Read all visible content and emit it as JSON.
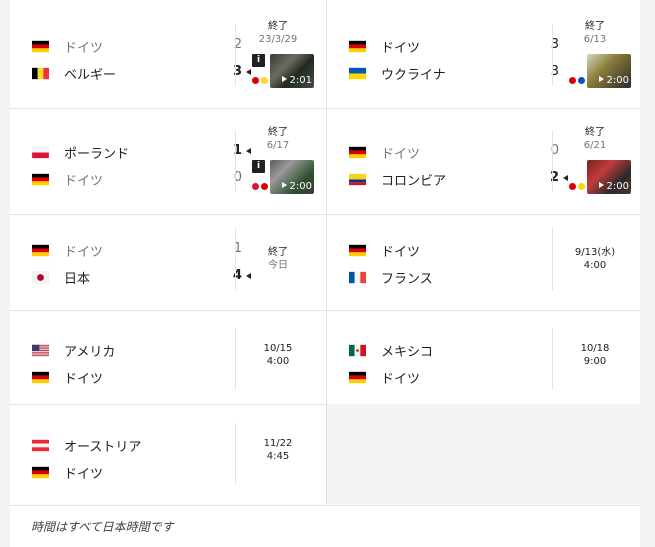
{
  "matches": [
    {
      "team1": {
        "name": "ドイツ",
        "flag": "de",
        "score": "2"
      },
      "team2": {
        "name": "ベルギー",
        "flag": "be",
        "score": "3"
      },
      "status": "終了",
      "date": "23/3/29",
      "video_duration": "2:01"
    },
    {
      "team1": {
        "name": "ドイツ",
        "flag": "de",
        "score": "3"
      },
      "team2": {
        "name": "ウクライナ",
        "flag": "ua",
        "score": "3"
      },
      "status": "終了",
      "date": "6/13",
      "video_duration": "2:00"
    },
    {
      "team1": {
        "name": "ポーランド",
        "flag": "pl",
        "score": "1"
      },
      "team2": {
        "name": "ドイツ",
        "flag": "de",
        "score": "0"
      },
      "status": "終了",
      "date": "6/17",
      "video_duration": "2:00"
    },
    {
      "team1": {
        "name": "ドイツ",
        "flag": "de",
        "score": "0"
      },
      "team2": {
        "name": "コロンビア",
        "flag": "co",
        "score": "2"
      },
      "status": "終了",
      "date": "6/21",
      "video_duration": "2:00"
    },
    {
      "team1": {
        "name": "ドイツ",
        "flag": "de",
        "score": "1"
      },
      "team2": {
        "name": "日本",
        "flag": "jp",
        "score": "4"
      },
      "status": "終了",
      "date": "今日"
    },
    {
      "team1": {
        "name": "ドイツ",
        "flag": "de"
      },
      "team2": {
        "name": "フランス",
        "flag": "fr"
      },
      "date": "9/13(水)",
      "time": "4:00"
    },
    {
      "team1": {
        "name": "アメリカ",
        "flag": "us"
      },
      "team2": {
        "name": "ドイツ",
        "flag": "de"
      },
      "date": "10/15",
      "time": "4:00"
    },
    {
      "team1": {
        "name": "メキシコ",
        "flag": "mx"
      },
      "team2": {
        "name": "ドイツ",
        "flag": "de"
      },
      "date": "10/18",
      "time": "9:00"
    },
    {
      "team1": {
        "name": "オーストリア",
        "flag": "at"
      },
      "team2": {
        "name": "ドイツ",
        "flag": "de"
      },
      "date": "11/22",
      "time": "4:45"
    }
  ],
  "footer_note": "時間はすべて日本時間です",
  "colors": {
    "text": "#202124",
    "muted": "#70757a",
    "divider": "#e0e3e7",
    "background": "#f1f3f4"
  }
}
